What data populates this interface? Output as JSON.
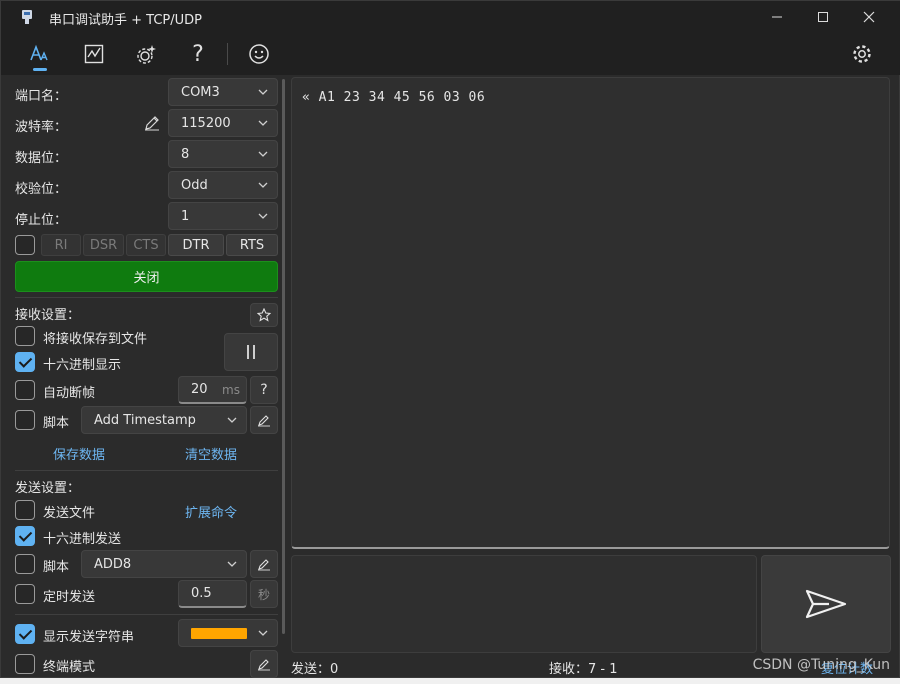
{
  "window": {
    "title": "串口调试助手 + TCP/UDP"
  },
  "toolbar": {
    "tools": [
      {
        "icon": "text-style-icon"
      },
      {
        "icon": "chart-icon"
      },
      {
        "icon": "sparkle-gear-icon"
      },
      {
        "icon": "help-icon",
        "label": "?"
      },
      {
        "icon": "smiley-icon"
      }
    ]
  },
  "serial": {
    "port_label": "端口名：",
    "port_value": "COM3",
    "baud_label": "波特率：",
    "baud_value": "115200",
    "data_label": "数据位：",
    "data_value": "8",
    "parity_label": "校验位：",
    "parity_value": "Odd",
    "stop_label": "停止位：",
    "stop_value": "1",
    "signals": [
      "RI",
      "DSR",
      "CTS",
      "DTR",
      "RTS"
    ],
    "close_label": "关闭"
  },
  "receive": {
    "header": "接收设置：",
    "save_to_file": "将接收保存到文件",
    "hex_display": "十六进制显示",
    "auto_frame": "自动断帧",
    "frame_ms_value": "20",
    "frame_ms_unit": "ms",
    "help_label": "?",
    "script_label": "脚本",
    "script_value": "Add Timestamp",
    "save_data": "保存数据",
    "clear_data": "清空数据"
  },
  "send": {
    "header": "发送设置：",
    "send_file": "发送文件",
    "ext_cmd": "扩展命令",
    "hex_send": "十六进制发送",
    "script_label": "脚本",
    "script_value": "ADD8",
    "timed_send": "定时发送",
    "interval_value": "0.5",
    "interval_unit": "秒",
    "show_send_string": "显示发送字符串",
    "send_color": "#ffa500",
    "terminal_mode": "终端模式"
  },
  "receive_area": {
    "text": "« A1 23 34 45 56 03 06"
  },
  "status": {
    "sent": "发送：0",
    "received": "接收：7 - 1",
    "reset": "复位计数"
  },
  "watermark": "CSDN @Tuning_Kun",
  "colors": {
    "accent": "#5fb2f2",
    "close_button": "#0f7b0f"
  }
}
